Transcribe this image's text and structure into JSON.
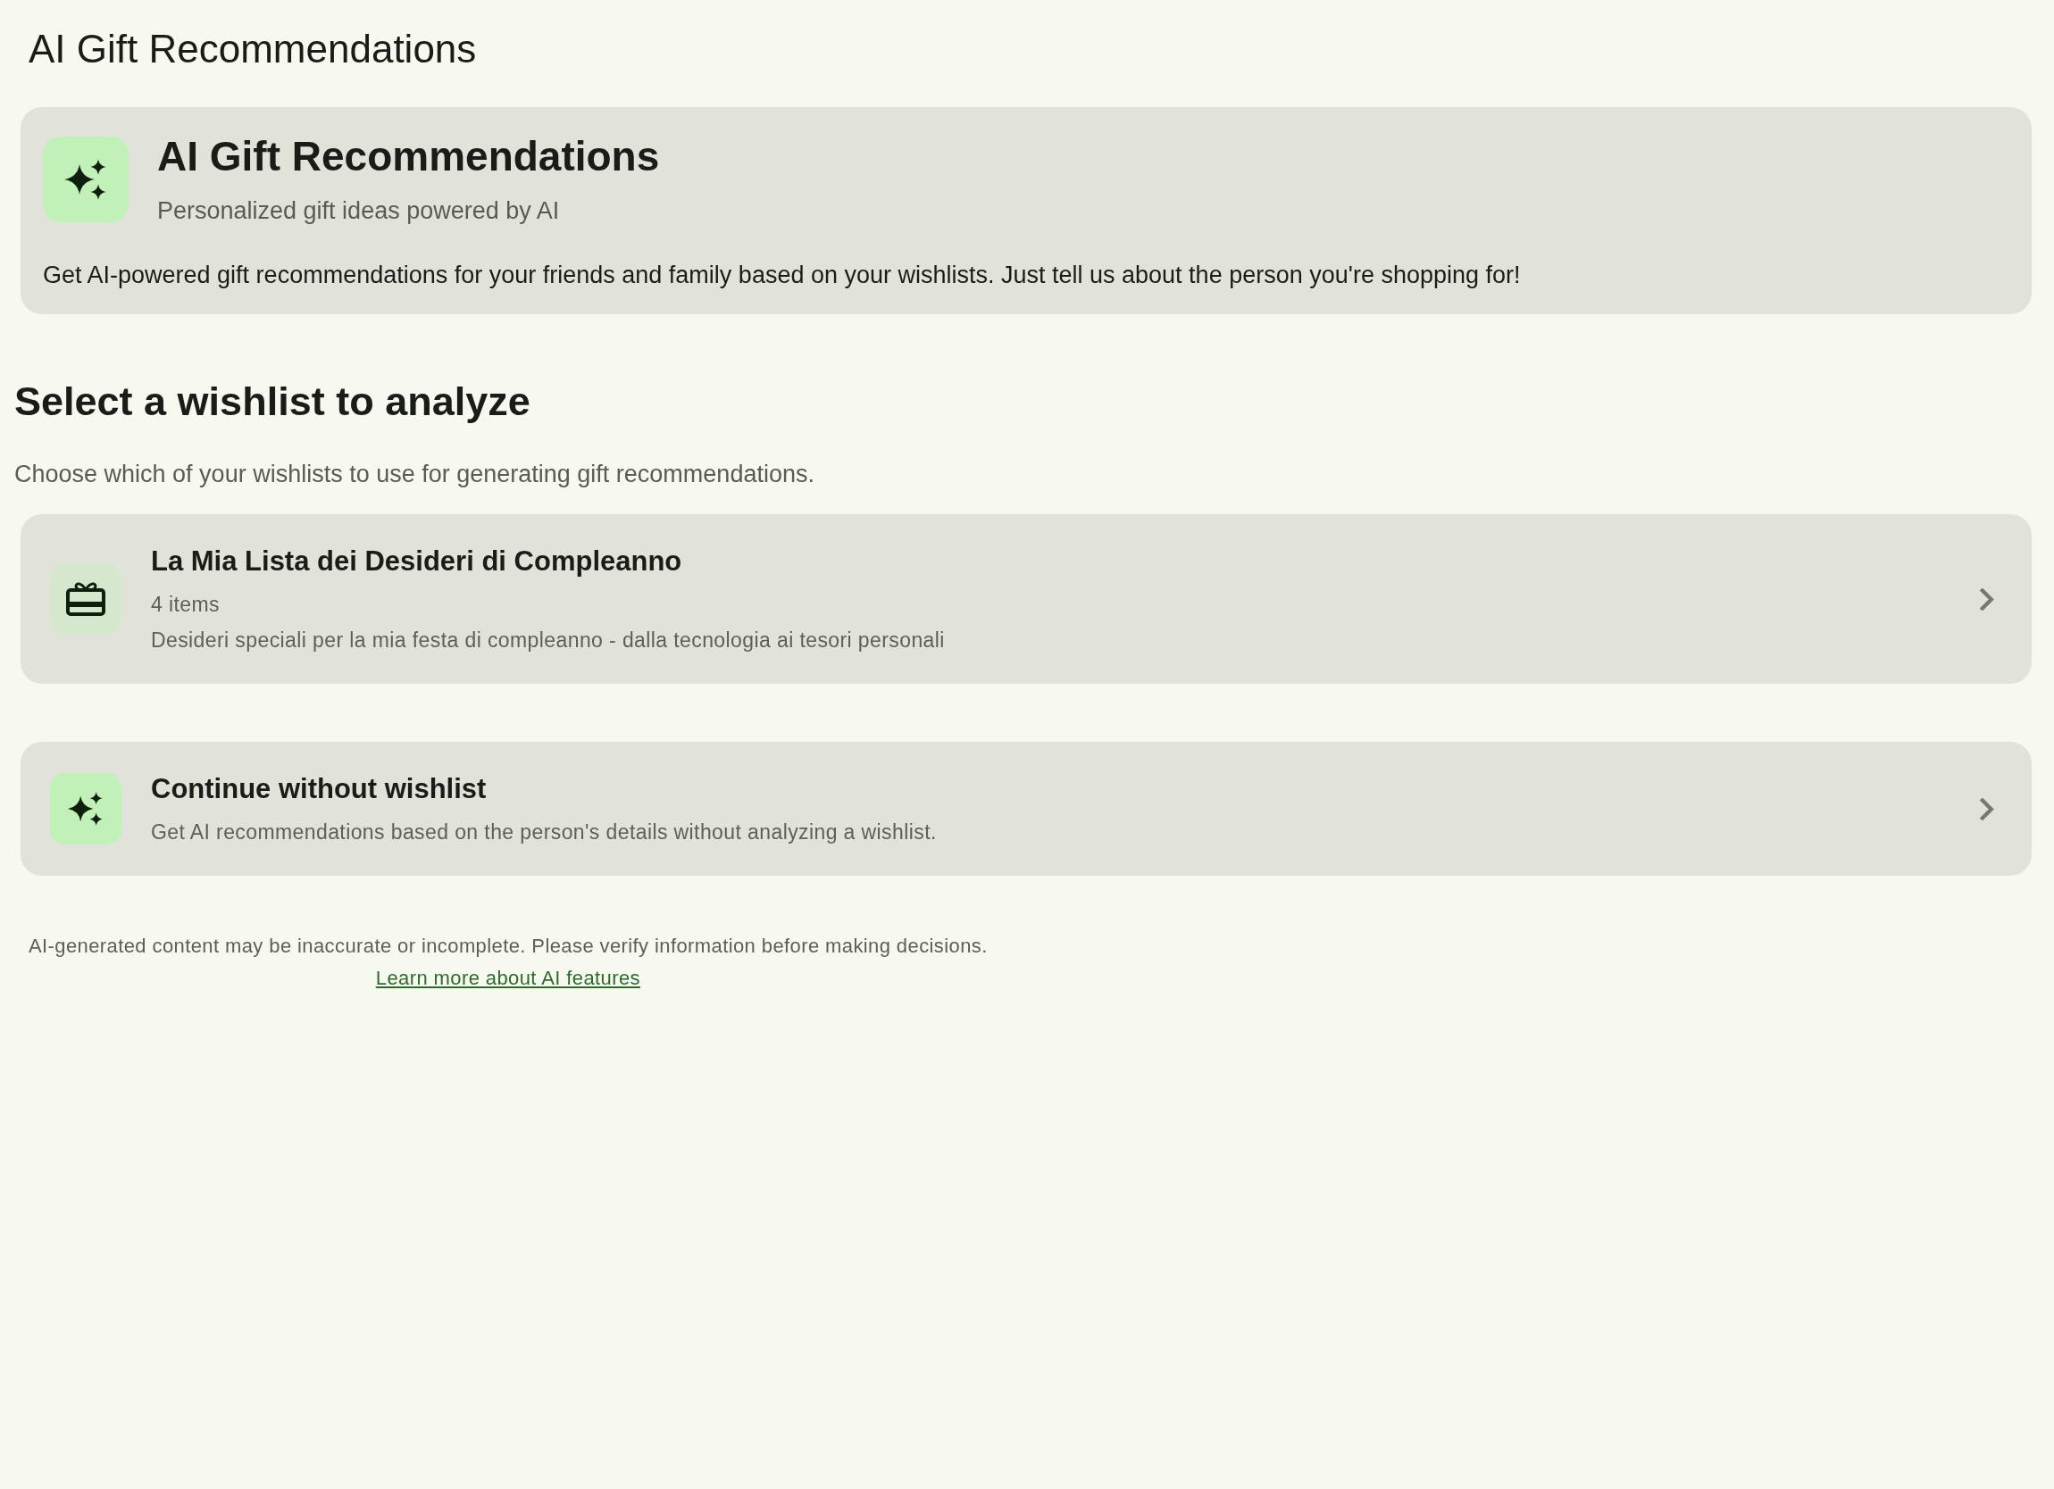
{
  "page": {
    "title": "AI Gift Recommendations"
  },
  "intro_card": {
    "title": "AI Gift Recommendations",
    "subtitle": "Personalized gift ideas powered by AI",
    "description": "Get AI-powered gift recommendations for your friends and family based on your wishlists. Just tell us about the person you're shopping for!"
  },
  "section": {
    "heading": "Select a wishlist to analyze",
    "description": "Choose which of your wishlists to use for generating gift recommendations."
  },
  "options": [
    {
      "kind": "wishlist",
      "title": "La Mia Lista dei Desideri di Compleanno",
      "item_count": "4 items",
      "description": "Desideri speciali per la mia festa di compleanno - dalla tecnologia ai tesori personali"
    },
    {
      "kind": "no_wishlist",
      "title": "Continue without wishlist",
      "description": "Get AI recommendations based on the person's details without analyzing a wishlist."
    }
  ],
  "footer": {
    "disclaimer": "AI-generated content may be inaccurate or incomplete. Please verify information before making decisions.",
    "link": "Learn more about AI features"
  }
}
